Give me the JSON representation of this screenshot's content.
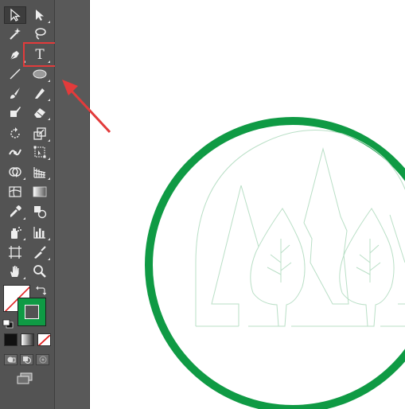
{
  "toolbar": {
    "type_tool_label": "T",
    "tools": [
      "selection-tool",
      "direct-selection-tool",
      "magic-wand-tool",
      "lasso-tool",
      "pen-tool",
      "type-tool",
      "line-segment-tool",
      "ellipse-tool",
      "paintbrush-tool",
      "pencil-tool",
      "blob-brush-tool",
      "eraser-tool",
      "rotate-tool",
      "scale-tool",
      "width-tool",
      "free-transform-tool",
      "shape-builder-tool",
      "perspective-grid-tool",
      "mesh-tool",
      "gradient-tool",
      "eyedropper-tool",
      "blend-tool",
      "symbol-sprayer-tool",
      "column-graph-tool",
      "artboard-tool",
      "slice-tool",
      "hand-tool",
      "zoom-tool"
    ],
    "active_tool": "selection-tool",
    "highlighted_tool": "type-tool"
  },
  "colors": {
    "toolbar_bg": "#535353",
    "gutter_bg": "#595959",
    "highlight": "#e23b3b",
    "logo_green": "#0f9a44",
    "logo_outline": "#b9dfc6",
    "stroke_swatch": "#0f9a44"
  }
}
